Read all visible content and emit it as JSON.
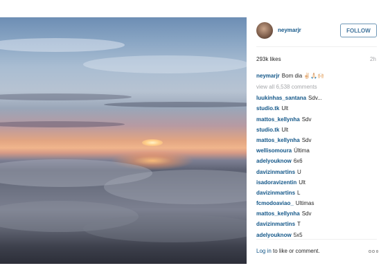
{
  "post": {
    "username": "neymarjr",
    "follow_label": "FOLLOW",
    "likes": "293k likes",
    "time": "2h",
    "caption_user": "neymarjr",
    "caption_text": "Bom dia ✌🏻🙏🏻🙌🏻",
    "view_all": "view all 6,538 comments"
  },
  "comments": [
    {
      "user": "luukinhas_santana",
      "text": "Sdv..."
    },
    {
      "user": "studio.tk",
      "text": "Ult"
    },
    {
      "user": "mattos_kellynha",
      "text": "Sdv"
    },
    {
      "user": "studio.tk",
      "text": "Ult"
    },
    {
      "user": "mattos_kellynha",
      "text": "Sdv"
    },
    {
      "user": "wellisomoura",
      "text": "Última"
    },
    {
      "user": "adelyouknow",
      "text": "6x6"
    },
    {
      "user": "davizinmartins",
      "text": "U"
    },
    {
      "user": "isadoravizentin",
      "text": "Ult"
    },
    {
      "user": "davizinmartins",
      "text": "L"
    },
    {
      "user": "fcmodoaviao_",
      "text": "Ultimas"
    },
    {
      "user": "mattos_kellynha",
      "text": "Sdv"
    },
    {
      "user": "davizinmartins",
      "text": "T"
    },
    {
      "user": "adelyouknow",
      "text": "5x5"
    }
  ],
  "footer": {
    "login_link": "Log in",
    "login_rest": "to like or comment."
  },
  "icons": {
    "more": "more-options-icon"
  }
}
